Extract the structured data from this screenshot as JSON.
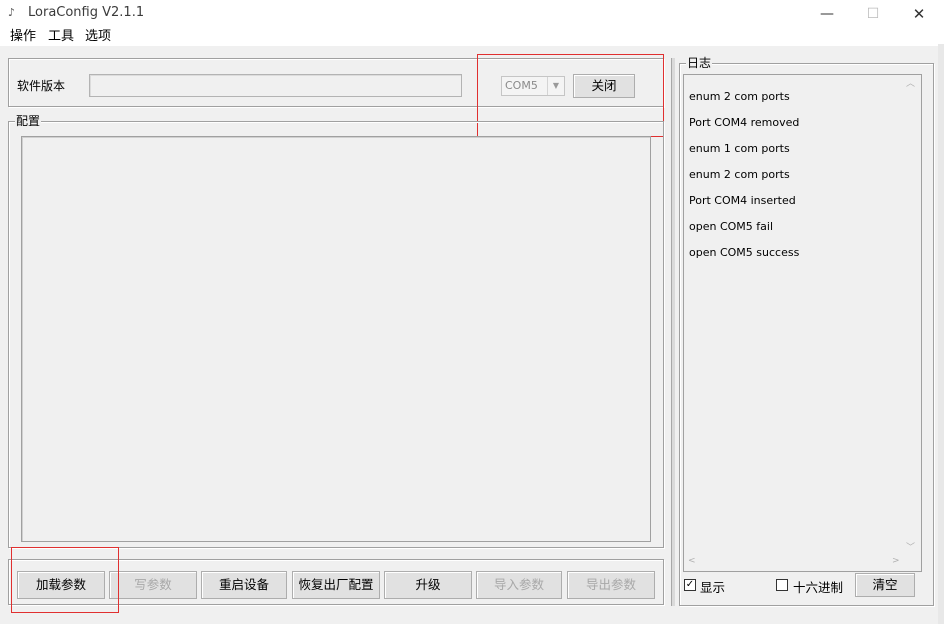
{
  "window": {
    "title": "LoraConfig V2.1.1",
    "icon": "app-icon",
    "controls": [
      "minimize-icon",
      "maximize-icon",
      "close-icon"
    ]
  },
  "menu": {
    "items": [
      "操作",
      "工具",
      "选项"
    ]
  },
  "version": {
    "label": "软件版本",
    "value": ""
  },
  "port": {
    "selected": "COM5",
    "button_label": "关闭"
  },
  "config": {
    "group_label": "配置"
  },
  "buttons": {
    "load_params": "加载参数",
    "write_params": "写参数",
    "restart_device": "重启设备",
    "factory_reset": "恢复出厂配置",
    "upgrade": "升级",
    "import_params": "导入参数",
    "export_params": "导出参数"
  },
  "log": {
    "group_label": "日志",
    "lines": [
      "enum 2 com ports",
      "Port COM4 removed",
      "enum 1 com ports",
      "enum 2 com ports",
      "Port COM4 inserted",
      "open COM5 fail",
      "open COM5 success"
    ],
    "show_label": "显示",
    "show_checked": true,
    "hex_label": "十六进制",
    "hex_checked": false,
    "clear_label": "清空"
  },
  "colors": {
    "highlight": "#e03030",
    "background": "#f0f0f0"
  }
}
